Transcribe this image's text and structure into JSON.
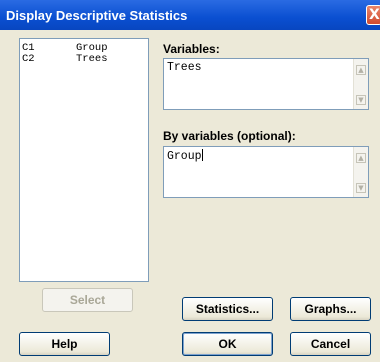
{
  "window": {
    "title": "Display Descriptive Statistics",
    "close_glyph": "X"
  },
  "variable_list": [
    {
      "col": "C1",
      "name": "Group"
    },
    {
      "col": "C2",
      "name": "Trees"
    }
  ],
  "variables": {
    "label": "Variables:",
    "value": "Trees"
  },
  "by_variables": {
    "label": "By variables (optional):",
    "value": "Group"
  },
  "buttons": {
    "select": "Select",
    "statistics": "Statistics...",
    "graphs": "Graphs...",
    "help": "Help",
    "ok": "OK",
    "cancel": "Cancel"
  },
  "icons": {
    "scroll_up": "up-arrow-icon",
    "scroll_down": "down-arrow-icon"
  },
  "colors": {
    "titlebar": "#0a4fd1",
    "dialog_bg": "#ece9d8",
    "field_border": "#7f9db9"
  }
}
